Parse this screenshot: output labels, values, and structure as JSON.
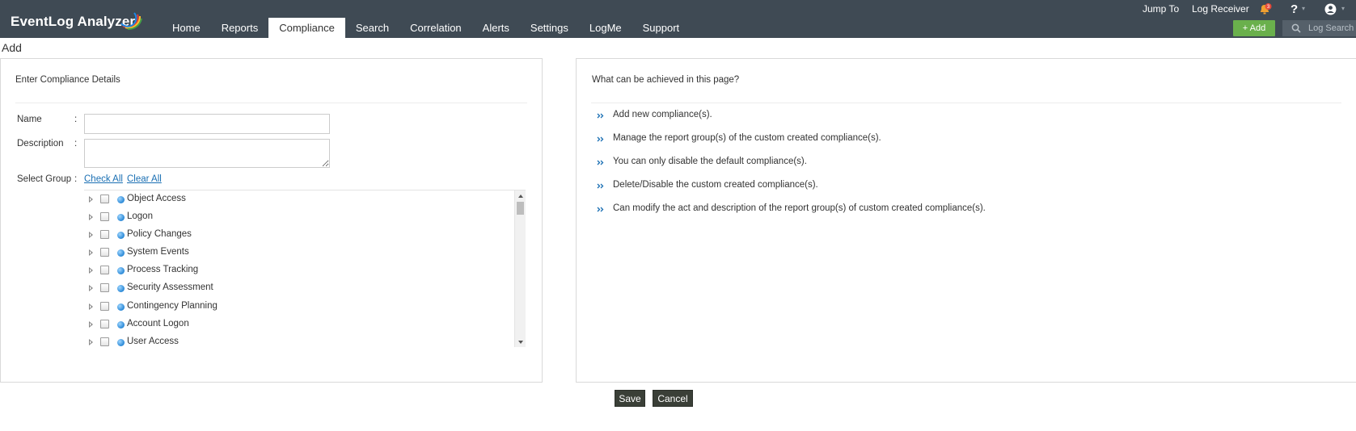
{
  "app": {
    "logo_text": "EventLog Analyzer"
  },
  "nav": {
    "items": [
      {
        "label": "Home"
      },
      {
        "label": "Reports"
      },
      {
        "label": "Compliance"
      },
      {
        "label": "Search"
      },
      {
        "label": "Correlation"
      },
      {
        "label": "Alerts"
      },
      {
        "label": "Settings"
      },
      {
        "label": "LogMe"
      },
      {
        "label": "Support"
      }
    ],
    "active": "Compliance"
  },
  "utility": {
    "jump_to": "Jump To",
    "log_receiver": "Log Receiver",
    "notification_count": "3",
    "help_glyph": "?",
    "add_label": "+ Add",
    "log_search_placeholder": "Log Search"
  },
  "page": {
    "heading": "Add"
  },
  "form": {
    "title": "Enter Compliance Details",
    "name_label": "Name",
    "name_value": "",
    "description_label": "Description",
    "description_value": "",
    "select_group_label": "Select Group",
    "colon": ":",
    "check_all": "Check All",
    "clear_all": "Clear All",
    "groups": [
      {
        "label": "Object Access"
      },
      {
        "label": "Logon"
      },
      {
        "label": "Policy Changes"
      },
      {
        "label": "System Events"
      },
      {
        "label": "Process Tracking"
      },
      {
        "label": "Security Assessment"
      },
      {
        "label": "Contingency Planning"
      },
      {
        "label": "Account Logon"
      },
      {
        "label": "User Access"
      }
    ]
  },
  "help_panel": {
    "title": "What can be achieved in this page?",
    "items": [
      {
        "text": "Add new compliance(s)."
      },
      {
        "text": "Manage the report group(s) of the custom created compliance(s)."
      },
      {
        "text": "You can only disable the default compliance(s)."
      },
      {
        "text": "Delete/Disable the custom created compliance(s)."
      },
      {
        "text": "Can modify the act and description of the report group(s) of custom created compliance(s)."
      }
    ]
  },
  "actions": {
    "save_label": "Save",
    "cancel_label": "Cancel"
  },
  "colors": {
    "topbar": "#3f4a54",
    "add_button": "#6ab04c",
    "link": "#1a6fb3",
    "footer_button": "#3a3f37",
    "notification_badge": "#e74c3c",
    "bell": "#f0a030"
  },
  "icons": {
    "logo_arc": "logo-swoosh-icon",
    "bell": "bell-icon",
    "user": "user-icon",
    "search": "search-icon",
    "tree_expand": "expand-triangle-icon",
    "group_bullet": "blue-globe-icon",
    "help_bullet": "double-chevron-icon"
  }
}
